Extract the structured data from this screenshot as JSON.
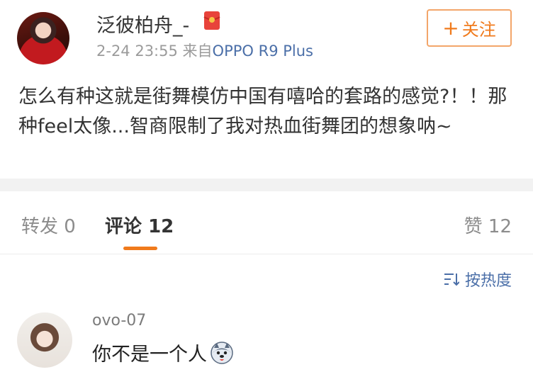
{
  "post": {
    "author_name": "泛彼柏舟_-",
    "timestamp": "2-24 23:55",
    "source_prefix": "来自",
    "device": "OPPO R9 Plus",
    "follow_plus": "+",
    "follow_label": "关注",
    "text": "怎么有种这就是街舞模仿中国有嘻哈的套路的感觉?！！那种feel太像...智商限制了我对热血街舞团的想象呐~"
  },
  "tabs": {
    "repost_label": "转发",
    "repost_count": "0",
    "comments_label": "评论",
    "comments_count": "12",
    "likes_label": "赞",
    "likes_count": "12"
  },
  "sort": {
    "label": "按热度",
    "icon": "sort-icon"
  },
  "comment": {
    "username": "ovo-07",
    "text": "你不是一个人",
    "emoji": "husky-emoji"
  },
  "colors": {
    "accent_orange": "#f07a1c",
    "link_blue": "#4b6fa8",
    "muted_gray": "#9b9b9b"
  }
}
